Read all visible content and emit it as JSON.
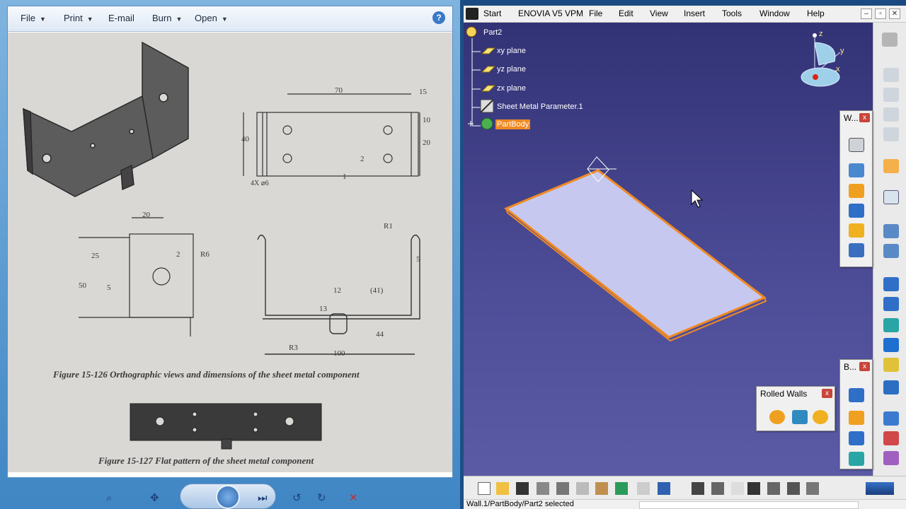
{
  "viewer": {
    "menu": [
      {
        "label": "File",
        "arrow": true
      },
      {
        "label": "Print",
        "arrow": true
      },
      {
        "label": "E-mail",
        "arrow": false
      },
      {
        "label": "Burn",
        "arrow": true
      },
      {
        "label": "Open",
        "arrow": true
      }
    ],
    "help_label": "?",
    "photo": {
      "dims": [
        "70",
        "15",
        "10",
        "20",
        "40",
        "4X ⌀6",
        "2",
        "1",
        "20",
        "25",
        "2",
        "R6",
        "50",
        "5",
        "R1",
        "5",
        "12",
        "(41)",
        "13",
        "44",
        "R3",
        "100"
      ],
      "caption1": "Figure 15-126  Orthographic views and dimensions of the sheet metal component",
      "caption2": "Figure 15-127  Flat pattern of the sheet metal component"
    },
    "controls": {
      "zoom": "⌕",
      "fit": "✥",
      "prev": "⏮",
      "next": "⏭",
      "rotate_ccw": "↺",
      "rotate_cw": "↻",
      "delete": "✕"
    }
  },
  "catia": {
    "menu": [
      {
        "label": "Start",
        "u": "S"
      },
      {
        "label": "ENOVIA V5 VPM",
        "u": ""
      },
      {
        "label": "File",
        "u": "F"
      },
      {
        "label": "Edit",
        "u": "E"
      },
      {
        "label": "View",
        "u": "V"
      },
      {
        "label": "Insert",
        "u": "I"
      },
      {
        "label": "Tools",
        "u": "T"
      },
      {
        "label": "Window",
        "u": "W"
      },
      {
        "label": "Help",
        "u": "H"
      }
    ],
    "tree": {
      "root": "Part2",
      "items": [
        "xy plane",
        "yz plane",
        "zx plane",
        "Sheet Metal Parameter.1"
      ],
      "partbody": "PartBody"
    },
    "compass": {
      "x": "x",
      "y": "y",
      "z": "z"
    },
    "toolbars": {
      "walls_title": "W...",
      "bends_title": "B...",
      "rolled_title": "Rolled Walls",
      "close": "x"
    },
    "status": "Wall.1/PartBody/Part2 selected",
    "colors": {
      "viewport_top": "#323276",
      "plate": "#c7c8ef",
      "plate_edge": "#f08a24",
      "highlight": "#f08a24"
    }
  }
}
